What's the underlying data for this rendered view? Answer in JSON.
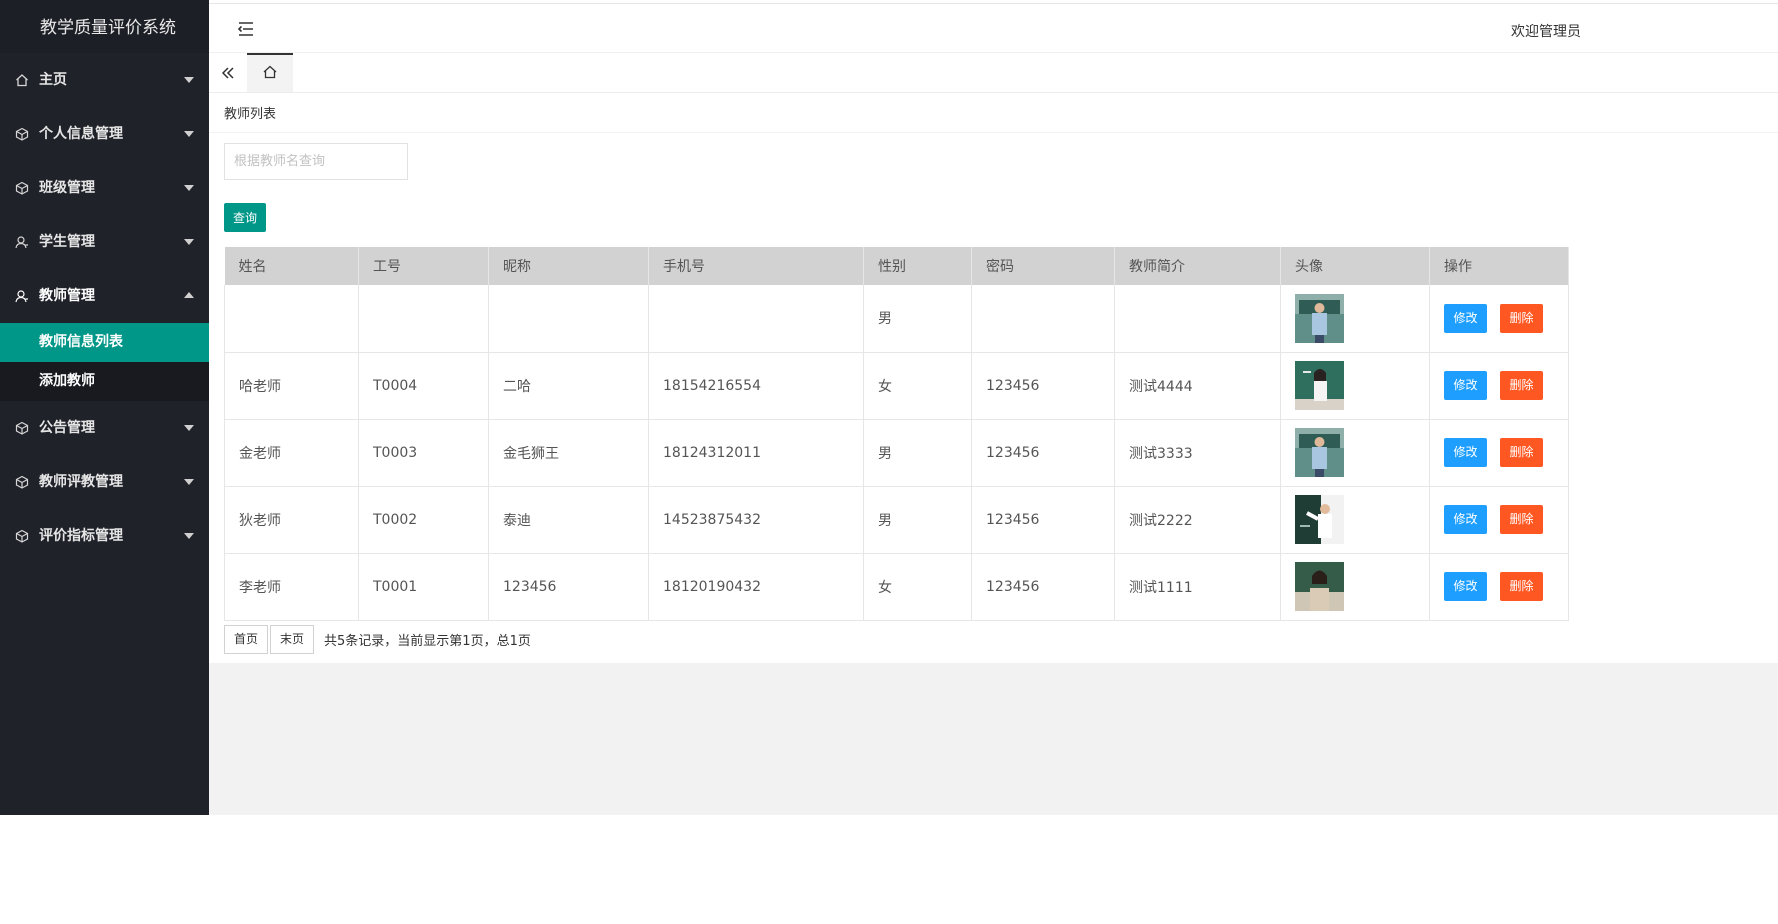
{
  "app": {
    "title": "教学质量评价系统"
  },
  "header": {
    "welcome": "欢迎管理员"
  },
  "sidebar": {
    "items": [
      {
        "label": "主页",
        "icon": "home-icon",
        "expanded": false
      },
      {
        "label": "个人信息管理",
        "icon": "cube-icon",
        "expanded": false
      },
      {
        "label": "班级管理",
        "icon": "cube-icon",
        "expanded": false
      },
      {
        "label": "学生管理",
        "icon": "user-icon",
        "expanded": false
      },
      {
        "label": "教师管理",
        "icon": "user-icon",
        "expanded": true,
        "children": [
          {
            "label": "教师信息列表",
            "active": true
          },
          {
            "label": "添加教师",
            "active": false
          }
        ]
      },
      {
        "label": "公告管理",
        "icon": "cube-icon",
        "expanded": false
      },
      {
        "label": "教师评教管理",
        "icon": "cube-icon",
        "expanded": false
      },
      {
        "label": "评价指标管理",
        "icon": "cube-icon",
        "expanded": false
      }
    ]
  },
  "page": {
    "title": "教师列表",
    "search": {
      "placeholder": "根据教师名查询",
      "value": ""
    },
    "query_label": "查询"
  },
  "table": {
    "columns": [
      "姓名",
      "工号",
      "昵称",
      "手机号",
      "性别",
      "密码",
      "教师简介",
      "头像",
      "操作"
    ],
    "rows": [
      {
        "name": "",
        "id": "",
        "nickname": "",
        "phone": "",
        "gender": "男",
        "password": "",
        "intro": "",
        "avatar": "male-teacher-classroom"
      },
      {
        "name": "哈老师",
        "id": "T0004",
        "nickname": "二哈",
        "phone": "18154216554",
        "gender": "女",
        "password": "123456",
        "intro": "测试4444",
        "avatar": "female-teacher-blackboard"
      },
      {
        "name": "金老师",
        "id": "T0003",
        "nickname": "金毛狮王",
        "phone": "18124312011",
        "gender": "男",
        "password": "123456",
        "intro": "测试3333",
        "avatar": "male-teacher-classroom"
      },
      {
        "name": "狄老师",
        "id": "T0002",
        "nickname": "泰迪",
        "phone": "14523875432",
        "gender": "男",
        "password": "123456",
        "intro": "测试2222",
        "avatar": "male-teacher-pointing"
      },
      {
        "name": "李老师",
        "id": "T0001",
        "nickname": "123456",
        "phone": "18120190432",
        "gender": "女",
        "password": "123456",
        "intro": "测试1111",
        "avatar": "female-teacher-smiling"
      }
    ],
    "edit_label": "修改",
    "delete_label": "删除"
  },
  "pager": {
    "first_label": "首页",
    "last_label": "末页",
    "info": "共5条记录，当前显示第1页，总1页"
  },
  "colors": {
    "sidebar_bg": "#20222a",
    "accent": "#009688",
    "edit": "#1e9fff",
    "delete": "#ff5722"
  }
}
